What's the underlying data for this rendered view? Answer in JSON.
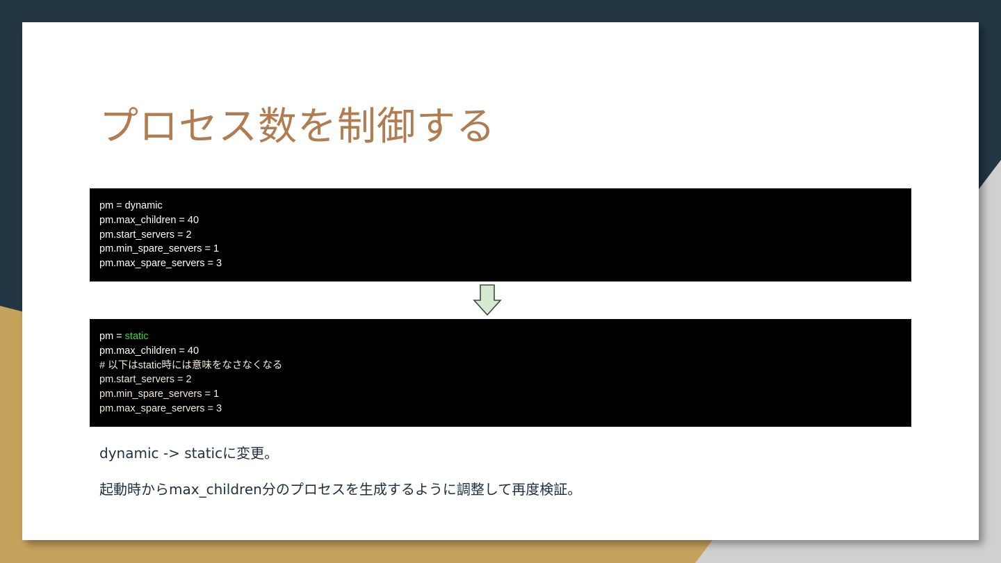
{
  "slide": {
    "title": "プロセス数を制御する",
    "colors": {
      "background_dark": "#223644",
      "background_tan": "#c6a35c",
      "background_grey": "#d0d0d0",
      "title": "#b07d52",
      "code_bg": "#000000",
      "code_text": "#ffffff",
      "highlight": "#3fd43f",
      "arrow_fill": "#d6e8cf",
      "arrow_stroke": "#3a4a3a",
      "body_text": "#1e2f3f"
    },
    "code_before": {
      "lines": [
        "pm = dynamic",
        "pm.max_children = 40",
        "pm.start_servers = 2",
        "pm.min_spare_servers = 1",
        "pm.max_spare_servers = 3"
      ]
    },
    "code_after": {
      "line1_prefix": "pm = ",
      "line1_value": "static",
      "line2": "pm.max_children = 40",
      "comment": "# 以下はstatic時には意味をなさなくなる",
      "line4": "pm.start_servers = 2",
      "line5": "pm.min_spare_servers = 1",
      "line6": "pm.max_spare_servers = 3"
    },
    "arrow_icon": "down-arrow-icon",
    "notes": [
      "dynamic -> staticに変更。",
      "起動時からmax_children分のプロセスを生成するように調整して再度検証。"
    ]
  }
}
